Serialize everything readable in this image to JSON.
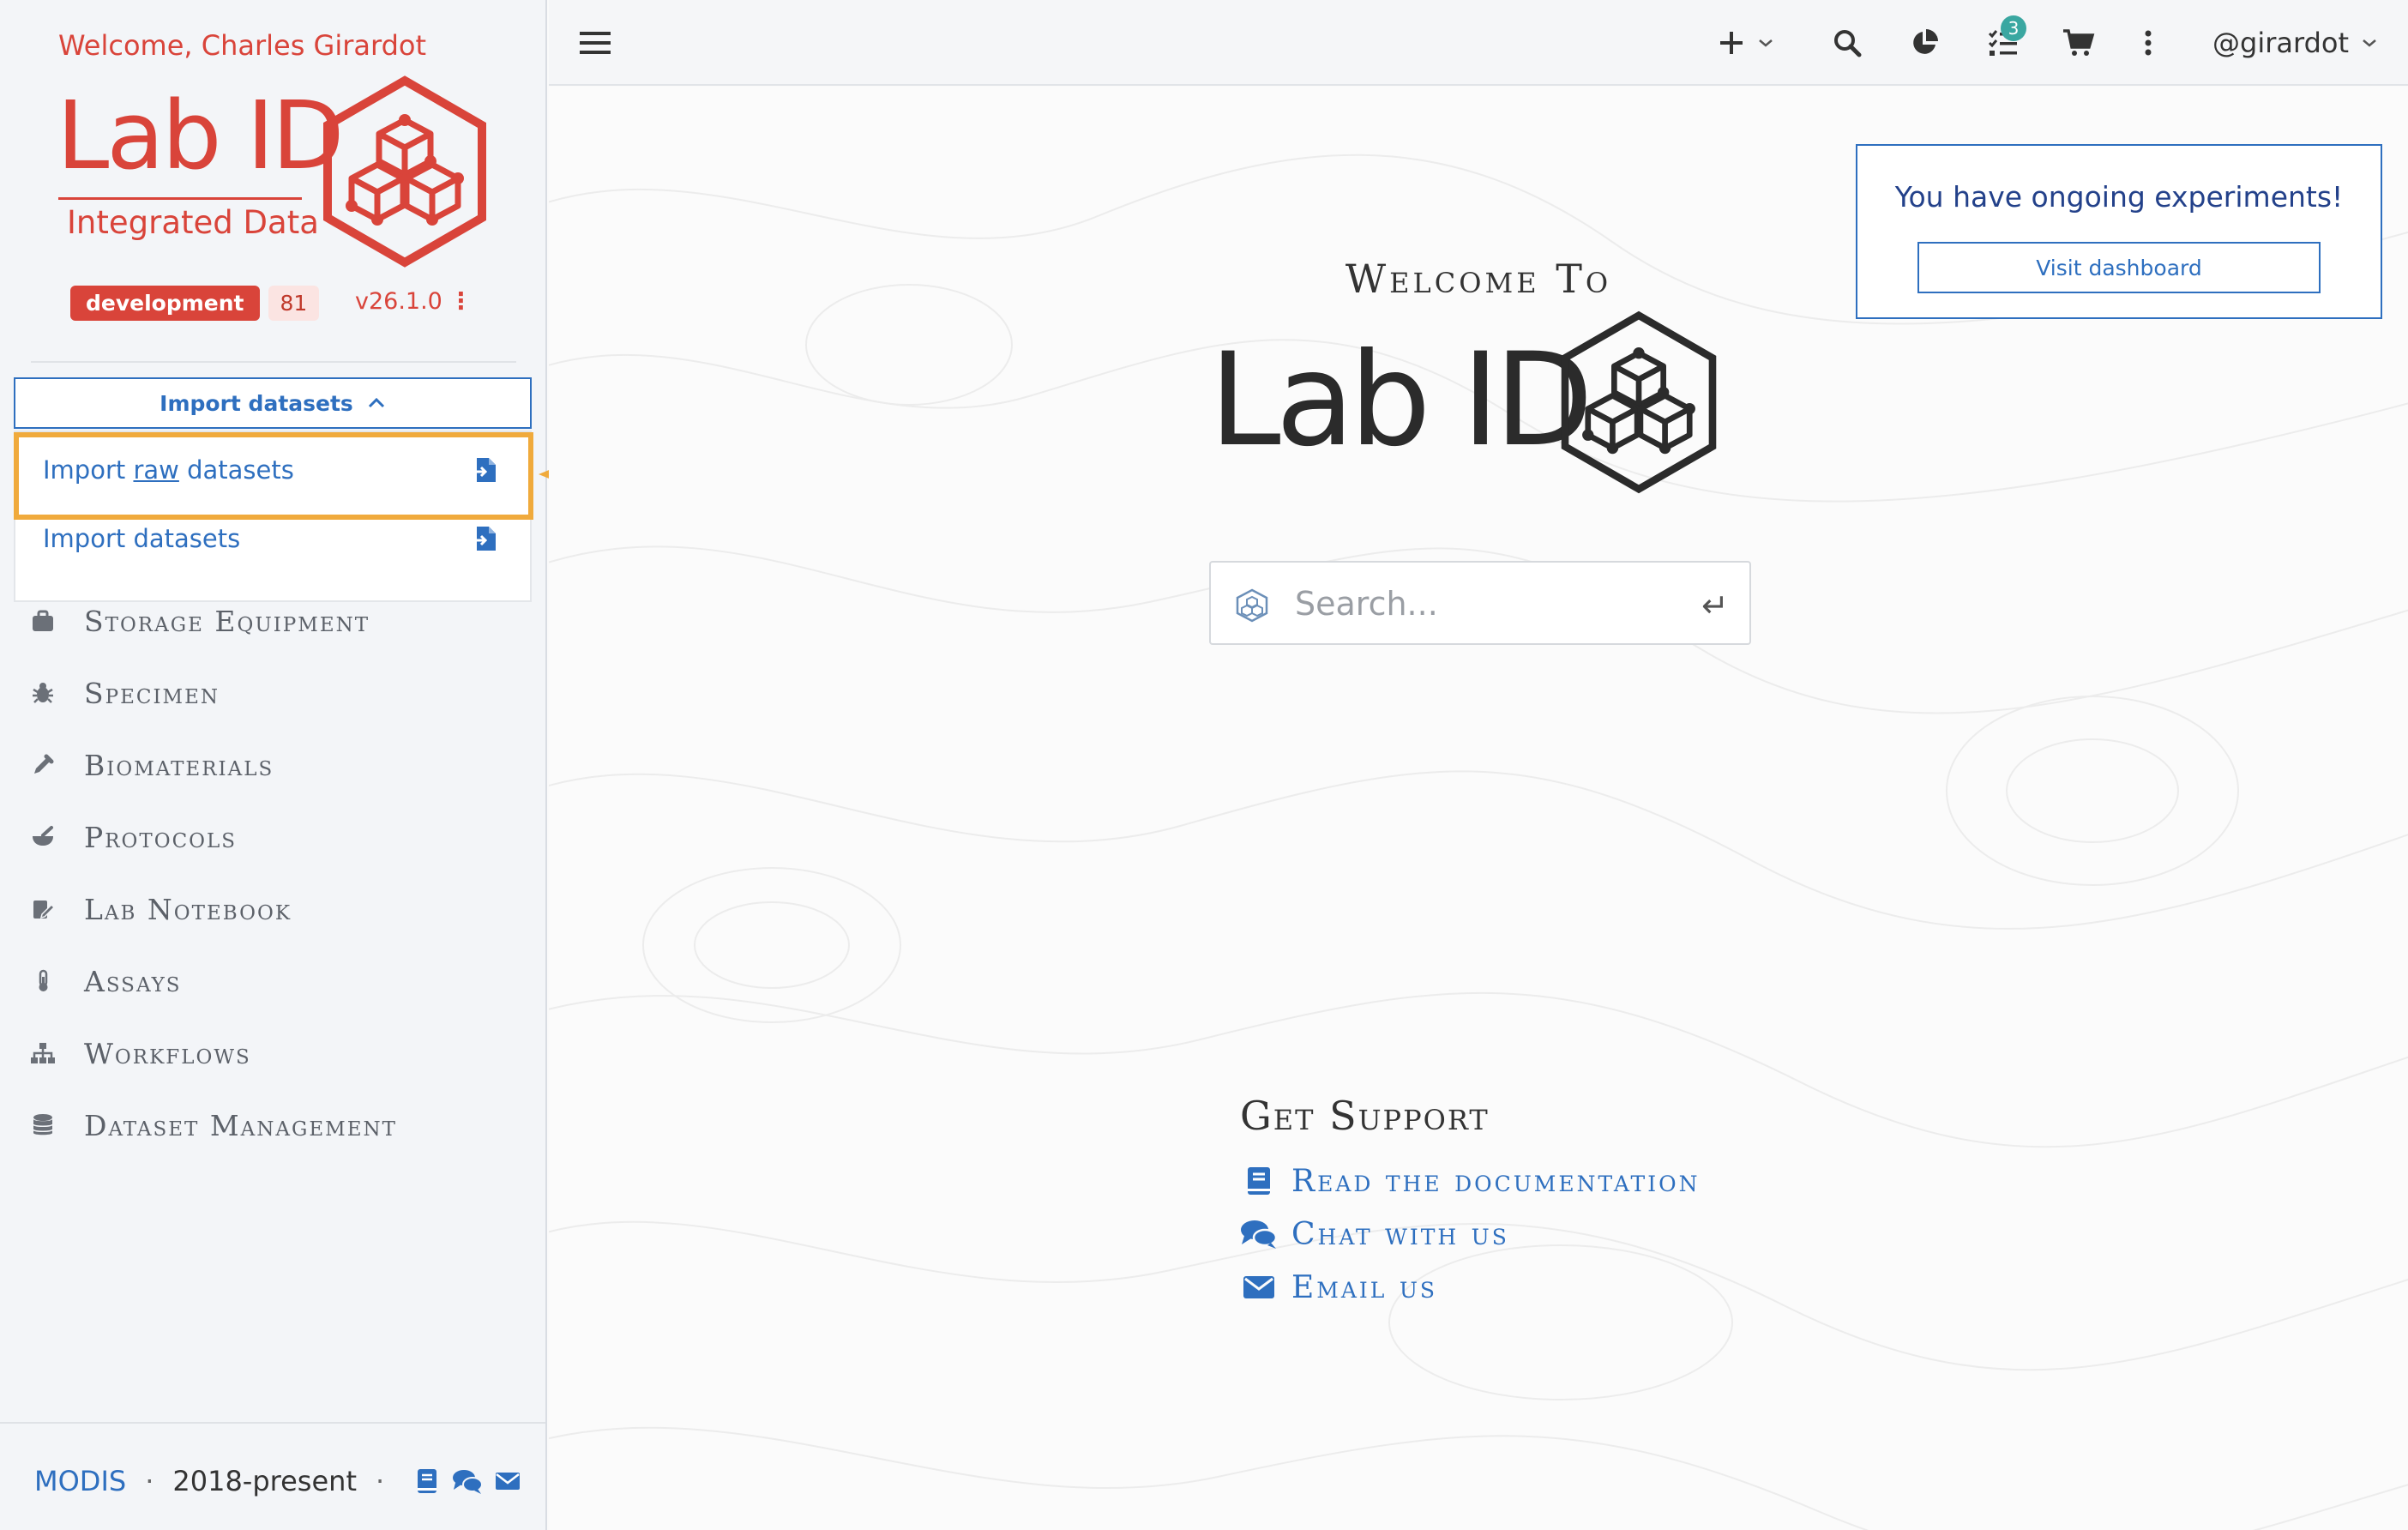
{
  "sidebar": {
    "welcome": "Welcome, Charles Girardot",
    "logo": {
      "word": "Lab ID",
      "subtitle": "Integrated Data"
    },
    "env_badge": "development",
    "env_count": "81",
    "version": "v26.1.0",
    "import_toggle_label": "Import datasets",
    "import_menu": {
      "raw_prefix": "Import ",
      "raw_word": "raw",
      "raw_suffix": " datasets",
      "datasets": "Import datasets"
    },
    "nav": [
      {
        "label": "Storage Equipment",
        "icon": "briefcase-icon"
      },
      {
        "label": "Specimen",
        "icon": "bug-icon"
      },
      {
        "label": "Biomaterials",
        "icon": "eyedropper-icon"
      },
      {
        "label": "Protocols",
        "icon": "mortar-pestle-icon"
      },
      {
        "label": "Lab Notebook",
        "icon": "notebook-pen-icon"
      },
      {
        "label": "Assays",
        "icon": "thermometer-icon"
      },
      {
        "label": "Workflows",
        "icon": "sitemap-icon"
      },
      {
        "label": "Dataset Management",
        "icon": "database-icon"
      }
    ],
    "footer": {
      "org": "MODIS",
      "years": "2018-present",
      "sep": "·"
    }
  },
  "topbar": {
    "tasks_count": "3",
    "username": "@girardot"
  },
  "main": {
    "notice": {
      "text": "You have ongoing experiments!",
      "button": "Visit dashboard"
    },
    "welcome_to": "Welcome To",
    "hero_word": "Lab ID",
    "search": {
      "placeholder": "Search...",
      "enter_glyph": "↵"
    },
    "support": {
      "title": "Get Support",
      "links": [
        {
          "label": "Read the documentation",
          "icon": "book-icon"
        },
        {
          "label": "Chat with us",
          "icon": "chat-bubbles-icon"
        },
        {
          "label": "Email us",
          "icon": "envelope-icon"
        }
      ]
    }
  },
  "colors": {
    "brand_red": "#d9443a",
    "link_blue": "#2e6fbf",
    "highlight_orange": "#f0aa3c",
    "badge_teal": "#3aa7a1"
  }
}
